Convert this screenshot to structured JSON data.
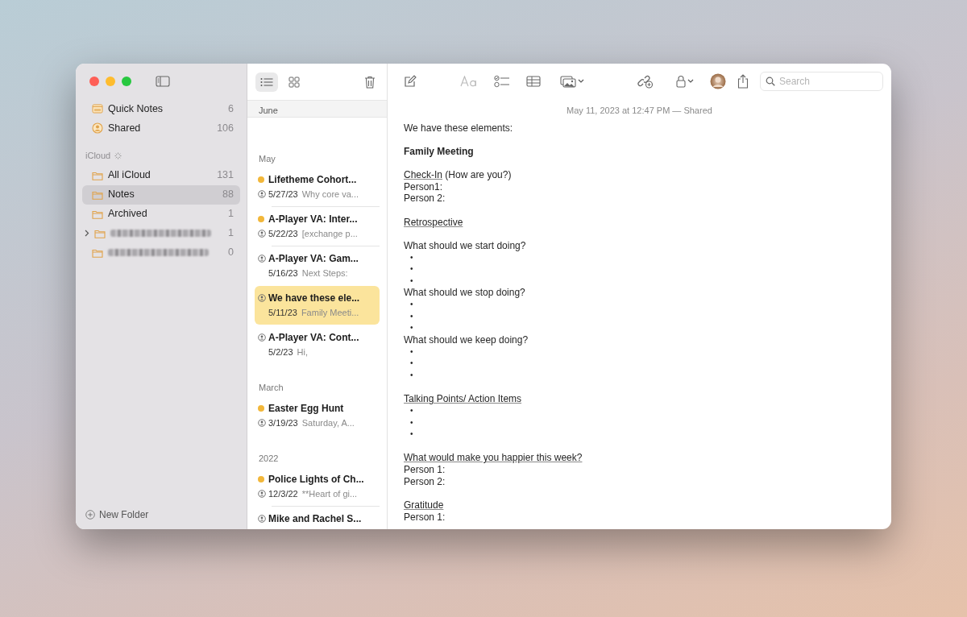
{
  "sidebar": {
    "pinned": [
      {
        "kind": "quick",
        "label": "Quick Notes",
        "count": "6",
        "selected": false
      },
      {
        "kind": "shared",
        "label": "Shared",
        "count": "106",
        "selected": false
      }
    ],
    "section": "iCloud",
    "folders": [
      {
        "kind": "folder",
        "label": "All iCloud",
        "count": "131",
        "selected": false
      },
      {
        "kind": "folder",
        "label": "Notes",
        "count": "88",
        "selected": true
      },
      {
        "kind": "folder",
        "label": "Archived",
        "count": "1",
        "selected": false
      },
      {
        "kind": "redacted",
        "count": "1",
        "selected": false,
        "expandable": true
      },
      {
        "kind": "redacted",
        "count": "0",
        "selected": false
      }
    ],
    "new_folder": "New Folder"
  },
  "note_list": {
    "view_buttons": [
      {
        "kind": "list",
        "selected": true
      },
      {
        "kind": "gallery",
        "selected": false
      }
    ],
    "sticky_header": "June",
    "sections": [
      {
        "title": "May",
        "notes": [
          {
            "title": "Lifetheme Cohort...",
            "date": "5/27/23",
            "preview": "Why core va...",
            "unread": true,
            "shared": true,
            "selected": false
          },
          {
            "title": "A-Player VA: Inter...",
            "date": "5/22/23",
            "preview": "[exchange p...",
            "unread": true,
            "shared": true,
            "selected": false
          },
          {
            "title": "A-Player VA: Gam...",
            "date": "5/16/23",
            "preview": "Next Steps:",
            "unread": false,
            "shared": true,
            "selected": false
          },
          {
            "title": "We have these ele...",
            "date": "5/11/23",
            "preview": "Family Meeti...",
            "unread": false,
            "shared": true,
            "selected": true
          },
          {
            "title": "A-Player VA: Cont...",
            "date": "5/2/23",
            "preview": "Hi,",
            "unread": false,
            "shared": true,
            "selected": false
          }
        ]
      },
      {
        "title": "March",
        "notes": [
          {
            "title": "Easter Egg Hunt",
            "date": "3/19/23",
            "preview": "Saturday, A...",
            "unread": true,
            "shared": true,
            "selected": false
          }
        ]
      },
      {
        "title": "2022",
        "notes": [
          {
            "title": "Police Lights of Ch...",
            "date": "12/3/22",
            "preview": "**Heart of gi...",
            "unread": true,
            "shared": true,
            "selected": false
          },
          {
            "title": "Mike and Rachel S...",
            "unread": false,
            "shared": true,
            "selected": false
          }
        ]
      }
    ]
  },
  "editor": {
    "search": {
      "placeholder": "Search"
    },
    "timestamp": "May 11, 2023 at 12:47 PM — Shared",
    "lines": [
      {
        "kind": "text",
        "text": "We have these elements:"
      },
      {
        "kind": "blank"
      },
      {
        "kind": "bold",
        "text": "Family Meeting"
      },
      {
        "kind": "blank"
      },
      {
        "kind": "heading",
        "text": "Check-In",
        "rest": " (How are you?)"
      },
      {
        "kind": "text",
        "text": "Person1:"
      },
      {
        "kind": "text",
        "text": "Person 2:"
      },
      {
        "kind": "blank"
      },
      {
        "kind": "heading",
        "text": "Retrospective"
      },
      {
        "kind": "blank"
      },
      {
        "kind": "text",
        "text": "What should we start doing?"
      },
      {
        "kind": "bullet",
        "text": "•"
      },
      {
        "kind": "bullet",
        "text": "•"
      },
      {
        "kind": "bullet",
        "text": "•"
      },
      {
        "kind": "text",
        "text": "What should we stop doing?"
      },
      {
        "kind": "bullet",
        "text": "•"
      },
      {
        "kind": "bullet",
        "text": "•"
      },
      {
        "kind": "bullet",
        "text": "•"
      },
      {
        "kind": "text",
        "text": "What should we keep doing?"
      },
      {
        "kind": "bullet",
        "text": "•"
      },
      {
        "kind": "bullet",
        "text": "•"
      },
      {
        "kind": "bullet",
        "text": "•"
      },
      {
        "kind": "blank"
      },
      {
        "kind": "heading",
        "text": "Talking Points/ Action Items"
      },
      {
        "kind": "bullet",
        "text": "•"
      },
      {
        "kind": "bullet",
        "text": "•"
      },
      {
        "kind": "bullet",
        "text": "•"
      },
      {
        "kind": "blank"
      },
      {
        "kind": "heading",
        "text": "What would make you happier this week?"
      },
      {
        "kind": "text",
        "text": "Person 1:"
      },
      {
        "kind": "text",
        "text": "Person 2:"
      },
      {
        "kind": "blank"
      },
      {
        "kind": "heading",
        "text": "Gratitude"
      },
      {
        "kind": "text",
        "text": "Person 1:"
      }
    ]
  }
}
